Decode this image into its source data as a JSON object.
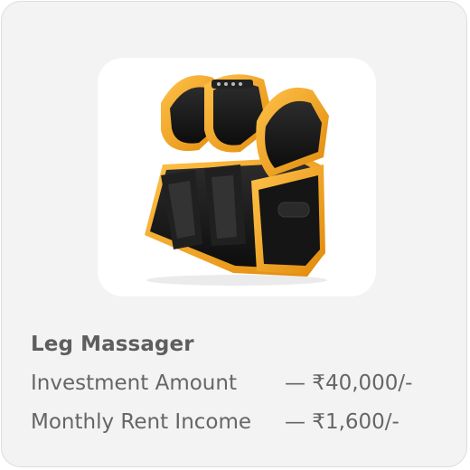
{
  "product": {
    "title": "Leg Massager",
    "image": "leg-massager-photo",
    "details": [
      {
        "label": "Investment Amount",
        "value": "— ₹40,000/-"
      },
      {
        "label": "Monthly Rent Income",
        "value": "— ₹1,600/-"
      }
    ]
  },
  "colors": {
    "card_background": "#f3f3f3",
    "card_border": "#dddddd",
    "image_background": "#ffffff",
    "title_text": "#5e5e5e",
    "body_text": "#666666",
    "product_orange": "#f4a51c",
    "product_black": "#1a1a1a"
  }
}
